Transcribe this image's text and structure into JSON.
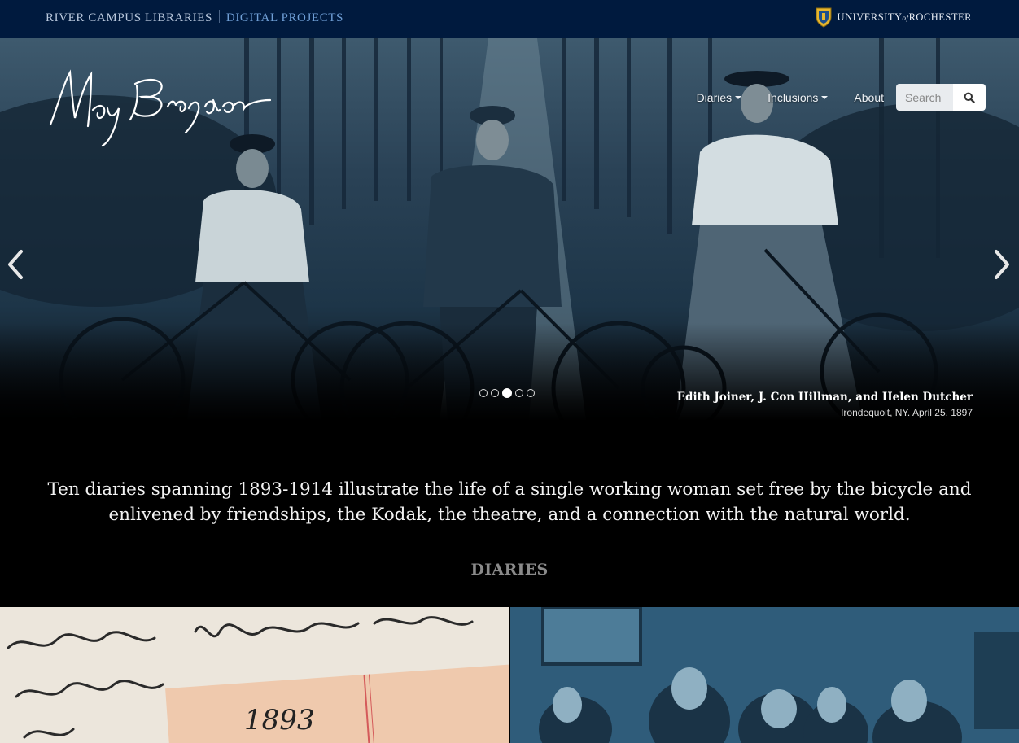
{
  "topbar": {
    "library": "RIVER CAMPUS LIBRARIES",
    "projects": "DIGITAL PROJECTS",
    "university_prefix": "UNIVERSITY",
    "university_of": "of",
    "university_name": "ROCHESTER"
  },
  "logo_text": "May Bragdon",
  "nav": {
    "diaries": "Diaries",
    "inclusions": "Inclusions",
    "about": "About",
    "search_placeholder": "Search"
  },
  "carousel": {
    "caption_title": "Edith Joiner, J. Con Hillman, and Helen Dutcher",
    "caption_sub": "Irondequoit, NY. April 25, 1897",
    "slide_count": 5,
    "active_slide": 3
  },
  "intro_text": "Ten diaries spanning 1893-1914 illustrate the life of a single working woman set free by the bicycle and enlivened by friendships, the Kodak, the theatre, and a connection with the natural world.",
  "section_title": "DIARIES",
  "tiles": [
    {
      "name": "1893",
      "year": "1893"
    },
    {
      "name": "group-photo"
    }
  ],
  "colors": {
    "topbar": "#001a3e",
    "link_accent": "#6f9fd6",
    "cyanotype": "#2a4a60"
  }
}
